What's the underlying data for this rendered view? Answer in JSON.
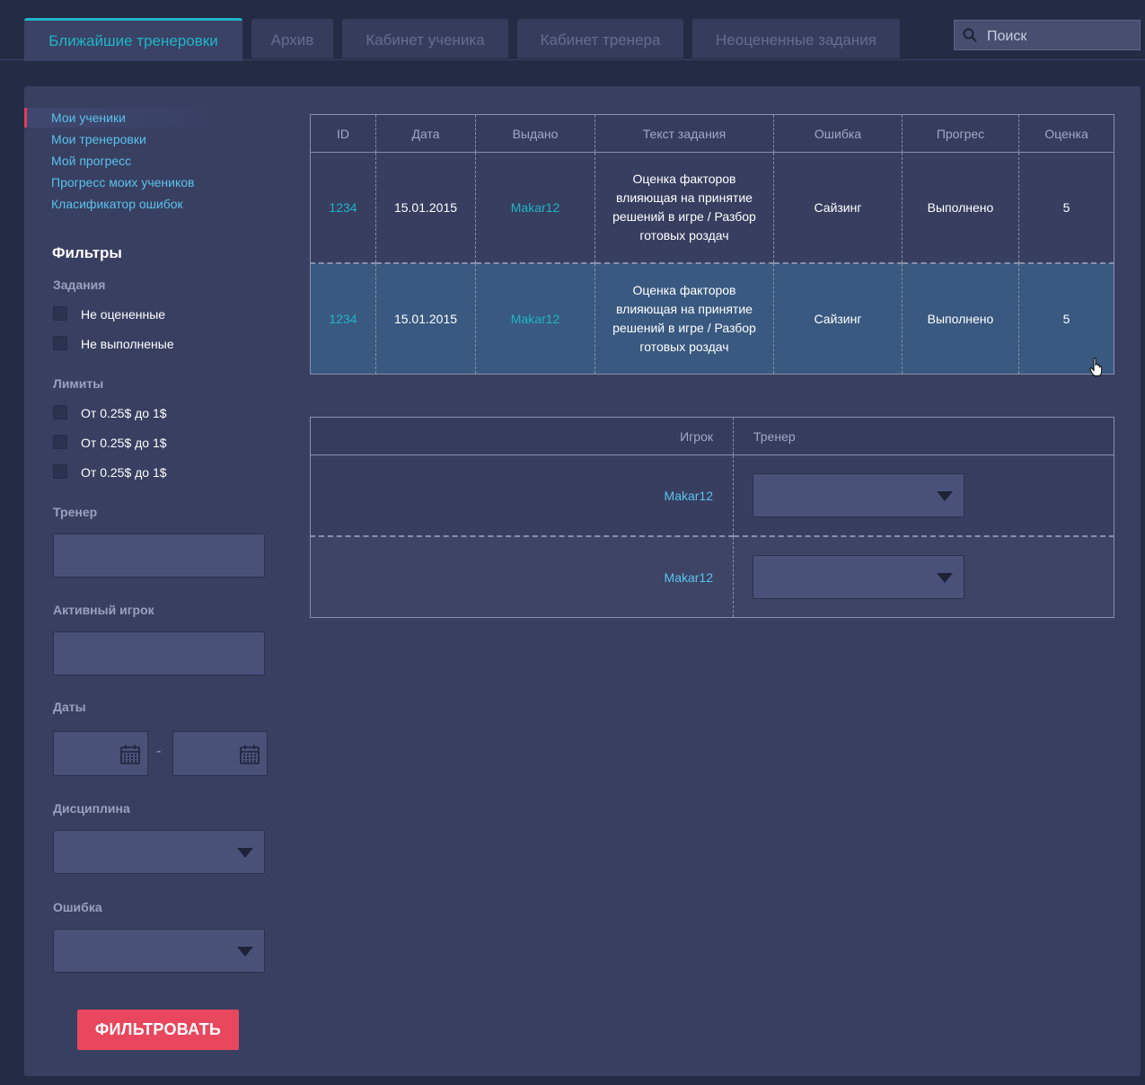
{
  "tabs": [
    {
      "label": "Ближайшие тренеровки",
      "active": true
    },
    {
      "label": "Архив",
      "active": false
    },
    {
      "label": "Кабинет ученика",
      "active": false
    },
    {
      "label": "Кабинет тренера",
      "active": false
    },
    {
      "label": "Неоцененные задания",
      "active": false
    }
  ],
  "search": {
    "placeholder": "Поиск",
    "icon": "search-icon"
  },
  "sidebar": {
    "items": [
      {
        "label": "Мои ученики",
        "active": true
      },
      {
        "label": "Мои тренеровки"
      },
      {
        "label": "Мой прогресс"
      },
      {
        "label": "Прогресс моих учеников"
      },
      {
        "label": "Класификатор ошибок"
      }
    ]
  },
  "filters": {
    "title": "Фильтры",
    "tasks_label": "Задания",
    "tasks": [
      "Не оцененные",
      "Не выполненые"
    ],
    "limits_label": "Лимиты",
    "limits": [
      "От 0.25$ до 1$",
      "От 0.25$ до 1$",
      "От 0.25$ до 1$"
    ],
    "coach_label": "Тренер",
    "active_player_label": "Активный игрок",
    "dates_label": "Даты",
    "dates_separator": "-",
    "discipline_label": "Дисциплина",
    "error_label": "Ошибка",
    "button_label": "ФИЛЬТРОВАТЬ"
  },
  "tasks_table": {
    "columns": [
      "ID",
      "Дата",
      "Выдано",
      "Текст задания",
      "Ошибка",
      "Прогрес",
      "Оценка"
    ],
    "rows": [
      {
        "id": "1234",
        "date": "15.01.2015",
        "issued": "Makar12",
        "text": "Оценка факторов влияющая на принятие решений в игре / Разбор готовых роздач",
        "error": "Сайзинг",
        "progress": "Выполнено",
        "score": "5"
      },
      {
        "id": "1234",
        "date": "15.01.2015",
        "issued": "Makar12",
        "text": "Оценка факторов влияющая на принятие решений в игре / Разбор готовых роздач",
        "error": "Сайзинг",
        "progress": "Выполнено",
        "score": "5"
      }
    ]
  },
  "players_table": {
    "columns": [
      "Игрок",
      "Тренер"
    ],
    "rows": [
      {
        "player": "Makar12",
        "coach": ""
      },
      {
        "player": "Makar12",
        "coach": ""
      }
    ]
  },
  "colors": {
    "accent": "#1fb5c5",
    "link": "#5bc2ec",
    "button": "#e8475d",
    "selected_row": "#395980"
  }
}
